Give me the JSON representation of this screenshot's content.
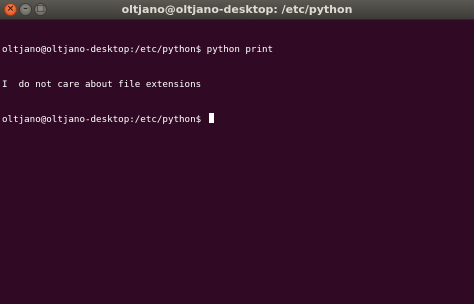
{
  "window": {
    "title": "oltjano@oltjano-desktop: /etc/python",
    "close_glyph": "×",
    "minimize_glyph": "–",
    "maximize_glyph": "□"
  },
  "terminal": {
    "lines": [
      "oltjano@oltjano-desktop:/etc/python$ python print",
      "I  do not care about file extensions"
    ],
    "prompt": "oltjano@oltjano-desktop:/etc/python$ ",
    "colors": {
      "background": "#300a24",
      "foreground": "#ffffff"
    }
  }
}
